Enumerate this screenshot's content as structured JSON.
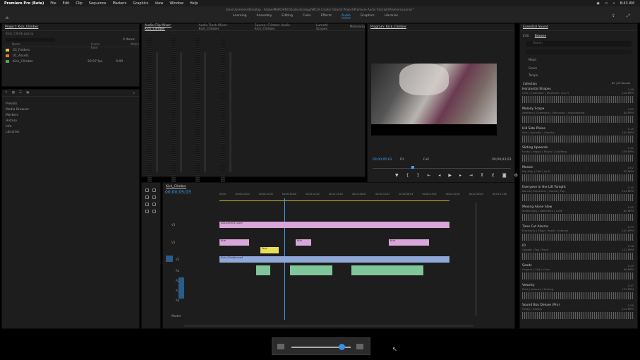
{
  "menubar": {
    "app": "Premiere Pro (Beta)",
    "items": [
      "File",
      "Edit",
      "Clip",
      "Sequence",
      "Markers",
      "Graphics",
      "View",
      "Window",
      "Help"
    ],
    "clock": "8:43 AM"
  },
  "workspace": {
    "doc_title": "/Users/premiere/Desktop - Adobe/MARCH/Kit/Studio Ecology/SRC/A Creator Tutorial Project/Premiere Audio Tutorial/[Premiere.prproj] *",
    "tabs": [
      "Learning",
      "Assembly",
      "Editing",
      "Color",
      "Effects",
      "Audio",
      "Graphics",
      "Libraries"
    ],
    "active_tab": "Audio"
  },
  "project": {
    "tab": "Project: Kick_Climber",
    "path": "Kick_Climb.prproj",
    "items_count": "4 Items",
    "columns": [
      "Name",
      "Frame Rate",
      "Media"
    ],
    "items": [
      {
        "name": "03_Folders",
        "color": "#e8c24a"
      },
      {
        "name": "01_Assets",
        "color": "#e87a2a"
      },
      {
        "name": "Kick_Climber",
        "color": "#4aa86a",
        "rate": "29.97 fps",
        "media": "0:00"
      }
    ]
  },
  "effects": {
    "folders": [
      "Presets",
      "Media Browser",
      "Markers",
      "History",
      "Info",
      "Libraries"
    ]
  },
  "mixer": {
    "tabs": [
      "Audio Clip Mixer: Kick_Climber",
      "Audio Track Mixer: Kick_Climber",
      "Source: Climber Audio Kick_Climber",
      "Lumetri Scopes",
      "Metadata"
    ],
    "channels": [
      "Audio 1",
      "Audio 2",
      "Audio 3",
      "Audio 4"
    ],
    "channel_prefix": [
      "A1",
      "A2",
      "A3",
      "A4"
    ]
  },
  "program": {
    "tab": "Program: Kick_Climber",
    "timecode_left": "00;00;05;03",
    "timecode_right": "00;00;43;03",
    "fit": "Fit",
    "quality": "Full"
  },
  "timeline": {
    "tab": "Kick_Climber",
    "timecode": "00;00;05;03",
    "ruler": [
      "00;00",
      "00;00;16;00",
      "00;00;32;00",
      "00;00;48;00",
      "00;01;04;02",
      "00;01;20;02",
      "00;01;36;02",
      "00;01;52;02",
      "00;02;08;04",
      "00;02;24;04",
      "00;02;40;04",
      "00;02;56;04",
      "00;03;12;06"
    ],
    "tracks_v": [
      "V3",
      "V2",
      "V1"
    ],
    "tracks_a": [
      "A1",
      "A2",
      "A3",
      "A4"
    ],
    "master": "Master",
    "clips": {
      "adjust": "Adjustment Layer",
      "v2a": "title",
      "v2b": "title",
      "v2c": "title",
      "v1": "Kick_Climber.mp4",
      "yellow": "Text"
    }
  },
  "essential_sound": {
    "tab": "Essential Sound",
    "subtabs": [
      "Edit",
      "Browse"
    ],
    "active_subtab": "Browse",
    "search_placeholder": "Search",
    "filters": [
      "Mood",
      "Genre",
      "Tempo"
    ],
    "section": "Collection",
    "count": "80 | 20 Results",
    "tracks": [
      {
        "title": "Horizontal Shapes",
        "sub": "Chill | Cinematic | Electronic | Lo-Fi",
        "dur": "1:49",
        "bpm": "118 BPM"
      },
      {
        "title": "Melody Scape",
        "sub": "Ambient | Cinematic | Electronic | Inspirational",
        "dur": "1:50",
        "bpm": "88 BPM"
      },
      {
        "title": "Hill Side Plains",
        "sub": "Folk | Acoustic | Country",
        "dur": "2:15",
        "bpm": "100 BPM"
      },
      {
        "title": "Sliding Upwards",
        "sub": "Funky | Happy | Playful | Uplifting",
        "dur": "1:41",
        "bpm": "108 BPM"
      },
      {
        "title": "Mosaic",
        "sub": "Hip-Hop | Chill | Lo-Fi",
        "dur": "2:02",
        "bpm": "90 BPM"
      },
      {
        "title": "Everyone in the Lift Tonight",
        "sub": "Dance | Electronic | House | Pop",
        "dur": "2:10",
        "bpm": "124 BPM"
      },
      {
        "title": "Moving Alone Slow",
        "sub": "Melancholy | Reflective | Calm",
        "dur": "1:55",
        "bpm": "80 BPM"
      },
      {
        "title": "Time Cut Alarms",
        "sub": "Electronic | Edgy | Hectic | Intense",
        "dur": "1:33",
        "bpm": "140 BPM"
      },
      {
        "title": "ID",
        "sub": "Upbeat | Pop | Rock",
        "dur": "1:28",
        "bpm": "122 BPM"
      },
      {
        "title": "Seeds",
        "sub": "Organic | Folk | Calm",
        "dur": "2:20",
        "bpm": "96 BPM"
      },
      {
        "title": "Velocity",
        "sub": "Rock | Intense | Driving",
        "dur": "1:47",
        "bpm": "132 BPM"
      },
      {
        "title": "Sound Box Deluxe (Pro)",
        "sub": "Funky | Groovy",
        "dur": "2:05",
        "bpm": "112 BPM"
      }
    ]
  },
  "zoom": {
    "level": 0.85
  }
}
